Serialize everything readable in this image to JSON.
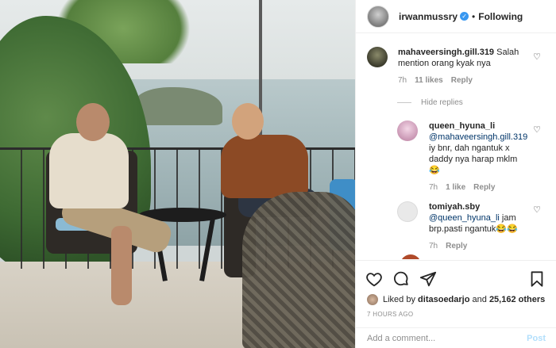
{
  "header": {
    "username": "irwanmussry",
    "separator": "•",
    "follow_status": "Following"
  },
  "comments": [
    {
      "username": "mahaveersingh.gill.319",
      "text": "Salah mention orang kyak nya",
      "time": "7h",
      "likes": "11 likes",
      "reply": "Reply"
    }
  ],
  "hide_replies": "Hide replies",
  "replies": [
    {
      "username": "queen_hyuna_li",
      "mention": "@mahaveersingh.gill.319",
      "text": "iy bnr, dah ngantuk x daddy nya harap mklm",
      "emoji": "😂",
      "time": "7h",
      "likes": "1 like",
      "reply": "Reply"
    },
    {
      "username": "tomiyah.sby",
      "mention": "@queen_hyuna_li",
      "text": "jam brp.pasti ngantuk😂😂",
      "time": "7h",
      "reply": "Reply"
    }
  ],
  "likes": {
    "prefix": "Liked by",
    "user": "ditasoedarjo",
    "and": "and",
    "count": "25,162 others"
  },
  "timestamp": "7 HOURS AGO",
  "add_comment": {
    "placeholder": "Add a comment...",
    "post": "Post"
  },
  "colors": {
    "verified": "#3897f0",
    "link": "#003569",
    "muted": "#8e8e8e",
    "post_disabled": "#b2dffc"
  }
}
